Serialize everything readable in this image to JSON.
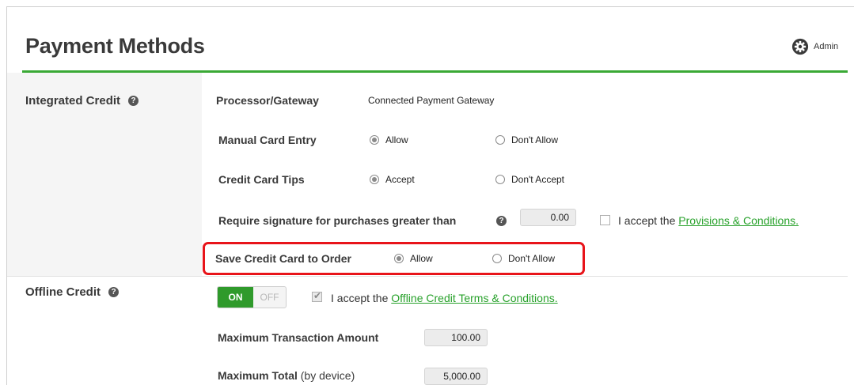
{
  "header": {
    "title": "Payment Methods",
    "admin_label": "Admin",
    "admin_icon": "gear-icon",
    "accent_color": "#3aa935"
  },
  "integrated_credit": {
    "label": "Integrated Credit",
    "processor_label": "Processor/Gateway",
    "processor_value": "Connected Payment Gateway",
    "manual_entry": {
      "label": "Manual Card Entry",
      "option_allow": "Allow",
      "option_deny": "Don't Allow",
      "selected": "Allow"
    },
    "tips": {
      "label": "Credit Card Tips",
      "option_accept": "Accept",
      "option_deny": "Don't Accept",
      "selected": "Accept"
    },
    "signature": {
      "label": "Require signature for purchases greater than",
      "value": "0.00",
      "accept_prefix": "I accept the",
      "accept_link": "Provisions & Conditions.",
      "accepted": false
    },
    "save_card": {
      "label": "Save Credit Card to Order",
      "option_allow": "Allow",
      "option_deny": "Don't Allow",
      "selected": "Allow",
      "highlight_color": "#e8141a"
    }
  },
  "offline_credit": {
    "label": "Offline Credit",
    "toggle_on": "ON",
    "toggle_off": "OFF",
    "enabled": true,
    "accept_prefix": "I accept the",
    "accept_link": "Offline Credit Terms & Conditions.",
    "accepted": true,
    "max_transaction": {
      "label": "Maximum Transaction Amount",
      "value": "100.00"
    },
    "max_total": {
      "label": "Maximum Total",
      "label_suffix": "(by device)",
      "value": "5,000.00"
    }
  }
}
